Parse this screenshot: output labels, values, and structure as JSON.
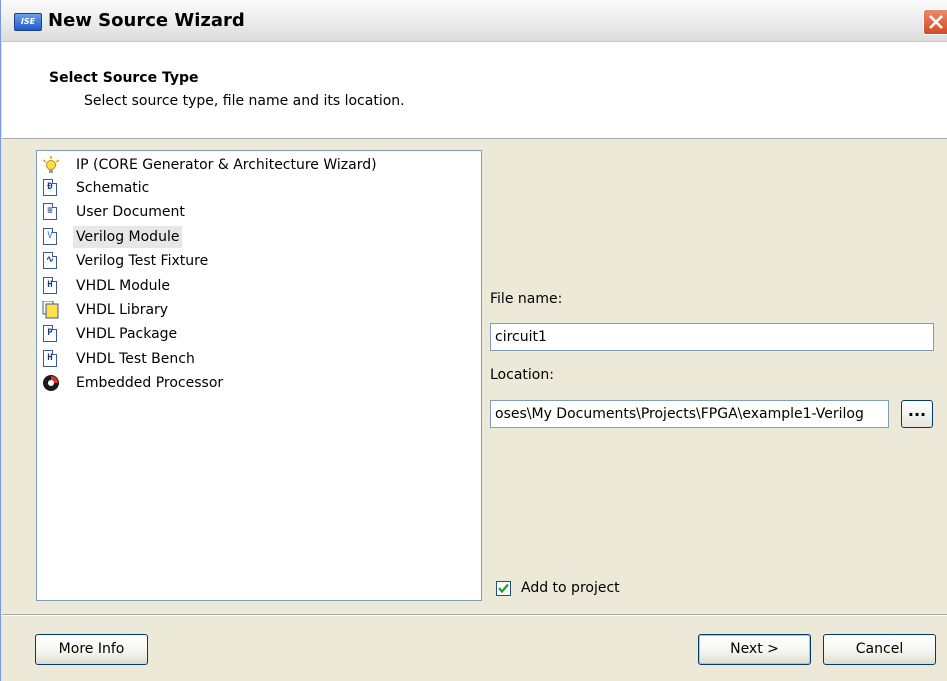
{
  "window": {
    "title": "New Source Wizard",
    "app_icon_text": "ISE"
  },
  "header": {
    "title": "Select Source Type",
    "subtitle": "Select source type, file name and its location."
  },
  "source_types": [
    {
      "label": "IP (CORE Generator & Architecture Wizard)",
      "icon": "lightbulb-icon"
    },
    {
      "label": "Schematic",
      "icon": "schematic-icon",
      "glyph": "Đ"
    },
    {
      "label": "User Document",
      "icon": "document-icon",
      "glyph": "≡"
    },
    {
      "label": "Verilog Module",
      "icon": "verilog-icon",
      "glyph": "V",
      "selected": true
    },
    {
      "label": "Verilog Test Fixture",
      "icon": "waveform-icon",
      "glyph": "∿"
    },
    {
      "label": "VHDL Module",
      "icon": "vhdl-icon",
      "glyph": "H"
    },
    {
      "label": "VHDL Library",
      "icon": "library-icon"
    },
    {
      "label": "VHDL Package",
      "icon": "package-icon",
      "glyph": "P"
    },
    {
      "label": "VHDL Test Bench",
      "icon": "testbench-icon",
      "glyph": "H"
    },
    {
      "label": "Embedded Processor",
      "icon": "processor-icon"
    }
  ],
  "form": {
    "file_name_label": "File name:",
    "file_name_value": "circuit1",
    "location_label": "Location:",
    "location_value": "oses\\My Documents\\Projects\\FPGA\\example1-Verilog",
    "browse_label": "...",
    "add_to_project_label": "Add to project",
    "add_to_project_checked": true
  },
  "buttons": {
    "more_info": "More Info",
    "next": "Next >",
    "cancel": "Cancel"
  },
  "colors": {
    "window_bg": "#ece9d8",
    "border_blue": "#7f9db9",
    "close_red": "#d24b22",
    "check_green": "#21a121"
  }
}
